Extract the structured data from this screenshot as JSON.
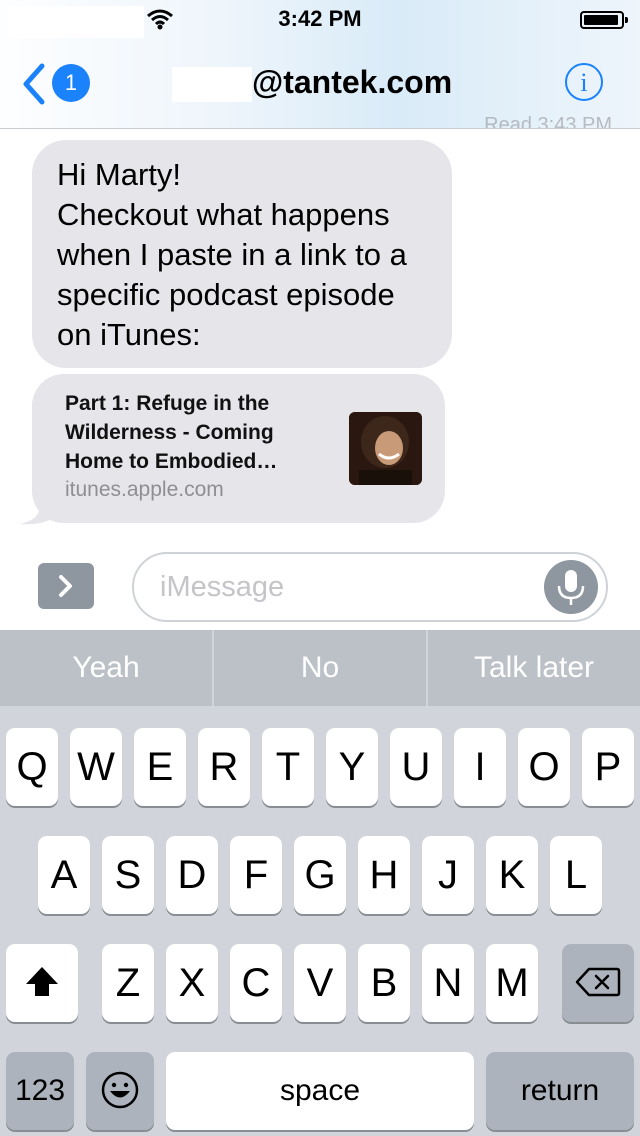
{
  "status_bar": {
    "time": "3:42 PM"
  },
  "nav": {
    "back_badge": "1",
    "contact": "@tantek.com",
    "info_icon": "info-icon"
  },
  "thread": {
    "read_receipt": "Read 3:43 PM",
    "message": "Hi Marty!\nCheckout what happens when I paste in a link to a specific podcast episode on iTunes:",
    "link_preview": {
      "title": "Part 1: Refuge in the\nWilderness - Coming\nHome to Embodied…",
      "domain": "itunes.apple.com"
    }
  },
  "compose": {
    "placeholder": "iMessage"
  },
  "quicktype": [
    "Yeah",
    "No",
    "Talk later"
  ],
  "keyboard": {
    "row1": [
      "Q",
      "W",
      "E",
      "R",
      "T",
      "Y",
      "U",
      "I",
      "O",
      "P"
    ],
    "row2": [
      "A",
      "S",
      "D",
      "F",
      "G",
      "H",
      "J",
      "K",
      "L"
    ],
    "row3": [
      "Z",
      "X",
      "C",
      "V",
      "B",
      "N",
      "M"
    ],
    "numbers": "123",
    "space": "space",
    "return": "return"
  },
  "colors": {
    "accent": "#1a82fb",
    "bubble": "#e5e5ea",
    "keyboard_bg": "#d1d5db"
  }
}
